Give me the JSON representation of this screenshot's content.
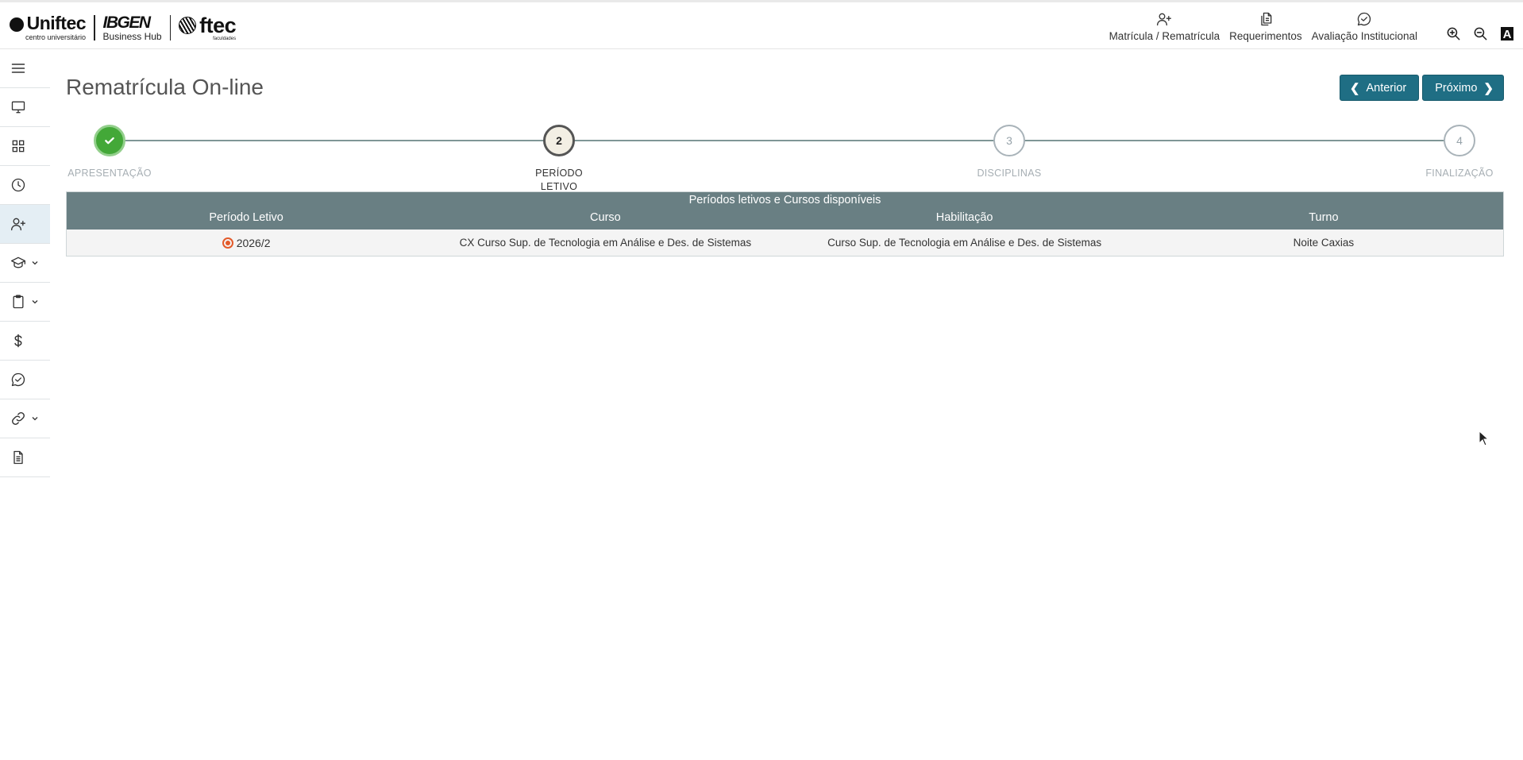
{
  "header": {
    "logos": [
      {
        "name": "Uniftec",
        "sub": "centro universitário"
      },
      {
        "name": "IBGEN",
        "sub": "Business Hub"
      },
      {
        "name": "ftec",
        "sub": "faculdades"
      }
    ],
    "nav": [
      {
        "label": "Matrícula / Rematrícula",
        "icon": "user-plus-icon"
      },
      {
        "label": "Requerimentos",
        "icon": "documents-icon"
      },
      {
        "label": "Avaliação Institucional",
        "icon": "chat-check-icon"
      }
    ],
    "tools": {
      "zoom_in": "zoom-in-icon",
      "zoom_out": "zoom-out-icon",
      "contrast_label": "A"
    }
  },
  "sidebar": {
    "items": [
      {
        "icon": "menu-icon"
      },
      {
        "icon": "monitor-icon"
      },
      {
        "icon": "grid-icon"
      },
      {
        "icon": "clock-icon"
      },
      {
        "icon": "user-plus-icon",
        "active": true
      },
      {
        "icon": "graduation-cap-icon",
        "has_submenu": true
      },
      {
        "icon": "clipboard-icon",
        "has_submenu": true
      },
      {
        "icon": "dollar-icon"
      },
      {
        "icon": "chat-check-icon"
      },
      {
        "icon": "link-icon",
        "has_submenu": true
      },
      {
        "icon": "document-icon"
      }
    ]
  },
  "page": {
    "title": "Rematrícula On-line",
    "prev_label": "Anterior",
    "next_label": "Próximo"
  },
  "stepper": {
    "steps": [
      {
        "number": "",
        "label": "APRESENTAÇÃO",
        "state": "done"
      },
      {
        "number": "2",
        "label": "PERÍODO LETIVO",
        "state": "current"
      },
      {
        "number": "3",
        "label": "DISCIPLINAS",
        "state": "pending"
      },
      {
        "number": "4",
        "label": "FINALIZAÇÃO",
        "state": "pending"
      }
    ]
  },
  "table": {
    "caption": "Períodos letivos e Cursos disponíveis",
    "columns": [
      "Período Letivo",
      "Curso",
      "Habilitação",
      "Turno"
    ],
    "rows": [
      {
        "periodo": "2026/2",
        "curso": "CX Curso Sup. de Tecnologia em Análise e Des. de Sistemas",
        "habilitacao": "Curso Sup. de Tecnologia em Análise e Des. de Sistemas",
        "turno": "Noite Caxias",
        "selected": true
      }
    ]
  },
  "colors": {
    "primary_button": "#1f6e84",
    "table_header": "#697f83",
    "step_done": "#43a838",
    "radio_selected": "#e35a2a"
  }
}
